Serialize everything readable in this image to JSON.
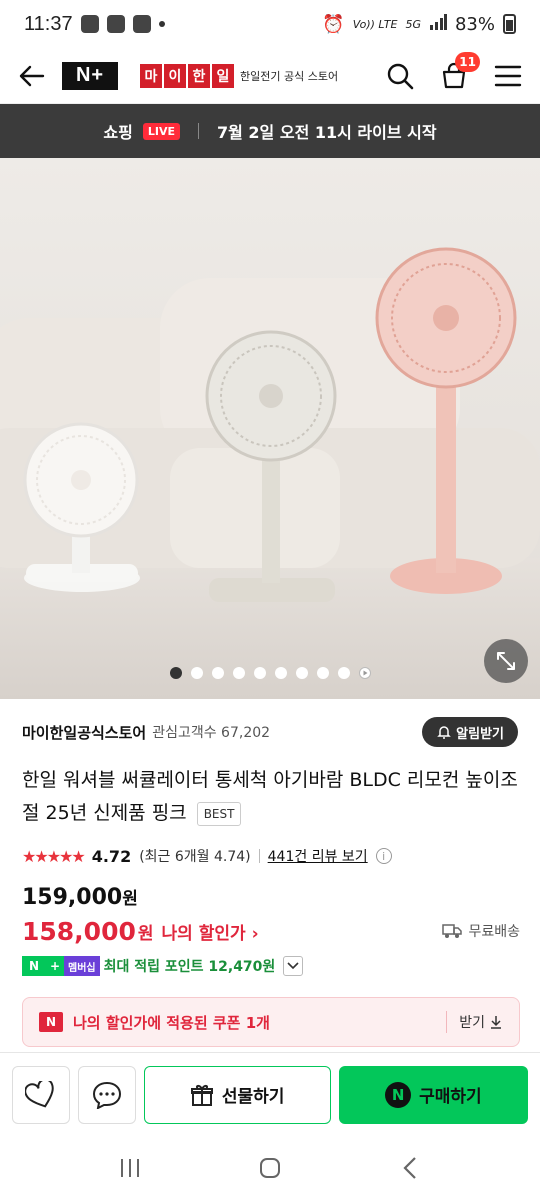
{
  "status": {
    "time": "11:37",
    "network": "5G",
    "carrier_small": "Vo)) LTE",
    "battery": "83%"
  },
  "header": {
    "back_icon": "arrow-left-icon",
    "nplus_logo": "N+",
    "brand_logo_chars": [
      "마",
      "이",
      "한",
      "일"
    ],
    "brand_sub": "한일전기 공식 스토어",
    "cart_count": "11"
  },
  "live_banner": {
    "prefix": "쇼핑",
    "tag": "LIVE",
    "text": "7월 2일 오전 11시 라이브 시작"
  },
  "gallery": {
    "slide_count": 10,
    "active_index": 0
  },
  "seller": {
    "name": "마이한일공식스토어",
    "followers": "관심고객수 67,202",
    "alarm_label": "알림받기"
  },
  "product": {
    "title": "한일 워셔블 써큘레이터 통세척 아기바람 BLDC 리모컨 높이조절 25년 신제품 핑크",
    "badge": "BEST"
  },
  "rating": {
    "stars": "★★★★★",
    "score": "4.72",
    "recent": "(최근 6개월 4.74)",
    "reviews": "441건 리뷰 보기",
    "info_icon": "i"
  },
  "price": {
    "original": "159,000",
    "original_unit": "원",
    "discounted": "158,000",
    "discounted_unit": "원",
    "discount_label": "나의 할인가",
    "chevron": "›",
    "shipping": "무료배송"
  },
  "points": {
    "badge_n": "N",
    "badge_plus": "+",
    "badge_member": "멤버십",
    "text": "최대 적립 포인트 12,470원"
  },
  "coupon": {
    "icon_letter": "N",
    "text": "나의 할인가에 적용된 쿠폰 1개",
    "action": "받기"
  },
  "actions": {
    "gift_label": "선물하기",
    "buy_label": "구매하기",
    "buy_icon_letter": "N"
  },
  "colors": {
    "naver_green": "#03c75a",
    "sale_red": "#e0263c",
    "live_red": "#ff2b3a",
    "banner_bg": "#3b3b3b"
  }
}
